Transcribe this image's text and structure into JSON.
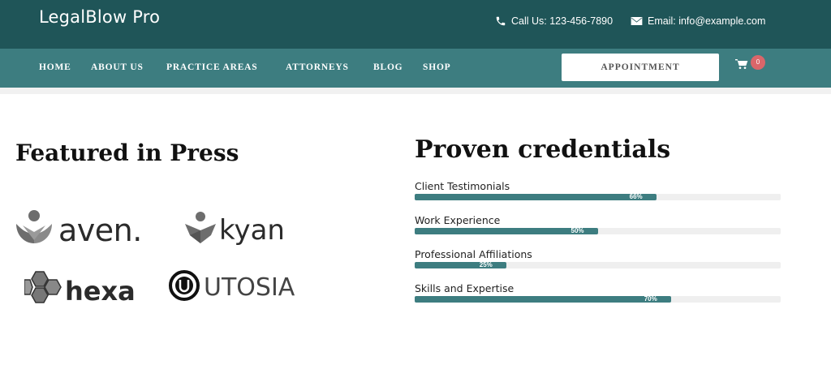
{
  "header": {
    "brand": "LegalBlow Pro",
    "phone_text": "Call Us: 123-456-7890",
    "email_text": "Email:  info@example.com"
  },
  "nav": {
    "items": [
      "HOME",
      "ABOUT US",
      "PRACTICE AREAS",
      "ATTORNEYS",
      "BLOG",
      "SHOP"
    ],
    "appointment_label": "APPOINTMENT",
    "cart_count": "0"
  },
  "press": {
    "title": "Featured in Press",
    "logos": [
      "aven.",
      "kyan",
      "hexa",
      "UTOSIA"
    ]
  },
  "credentials": {
    "title": "Proven credentials",
    "skills": [
      {
        "label": "Client Testimonials",
        "value": 66,
        "display": "66%"
      },
      {
        "label": "Work Experience",
        "value": 50,
        "display": "50%"
      },
      {
        "label": "Professional Affiliations",
        "value": 25,
        "display": "25%"
      },
      {
        "label": "Skills and Expertise",
        "value": 70,
        "display": "70%"
      }
    ]
  },
  "colors": {
    "topbar": "#1f5558",
    "navbar": "#3d7d80",
    "accent": "#3d7d80",
    "badge": "#d9666a"
  },
  "icons": {
    "phone": "phone-icon",
    "email": "envelope-icon",
    "cart": "cart-icon"
  }
}
